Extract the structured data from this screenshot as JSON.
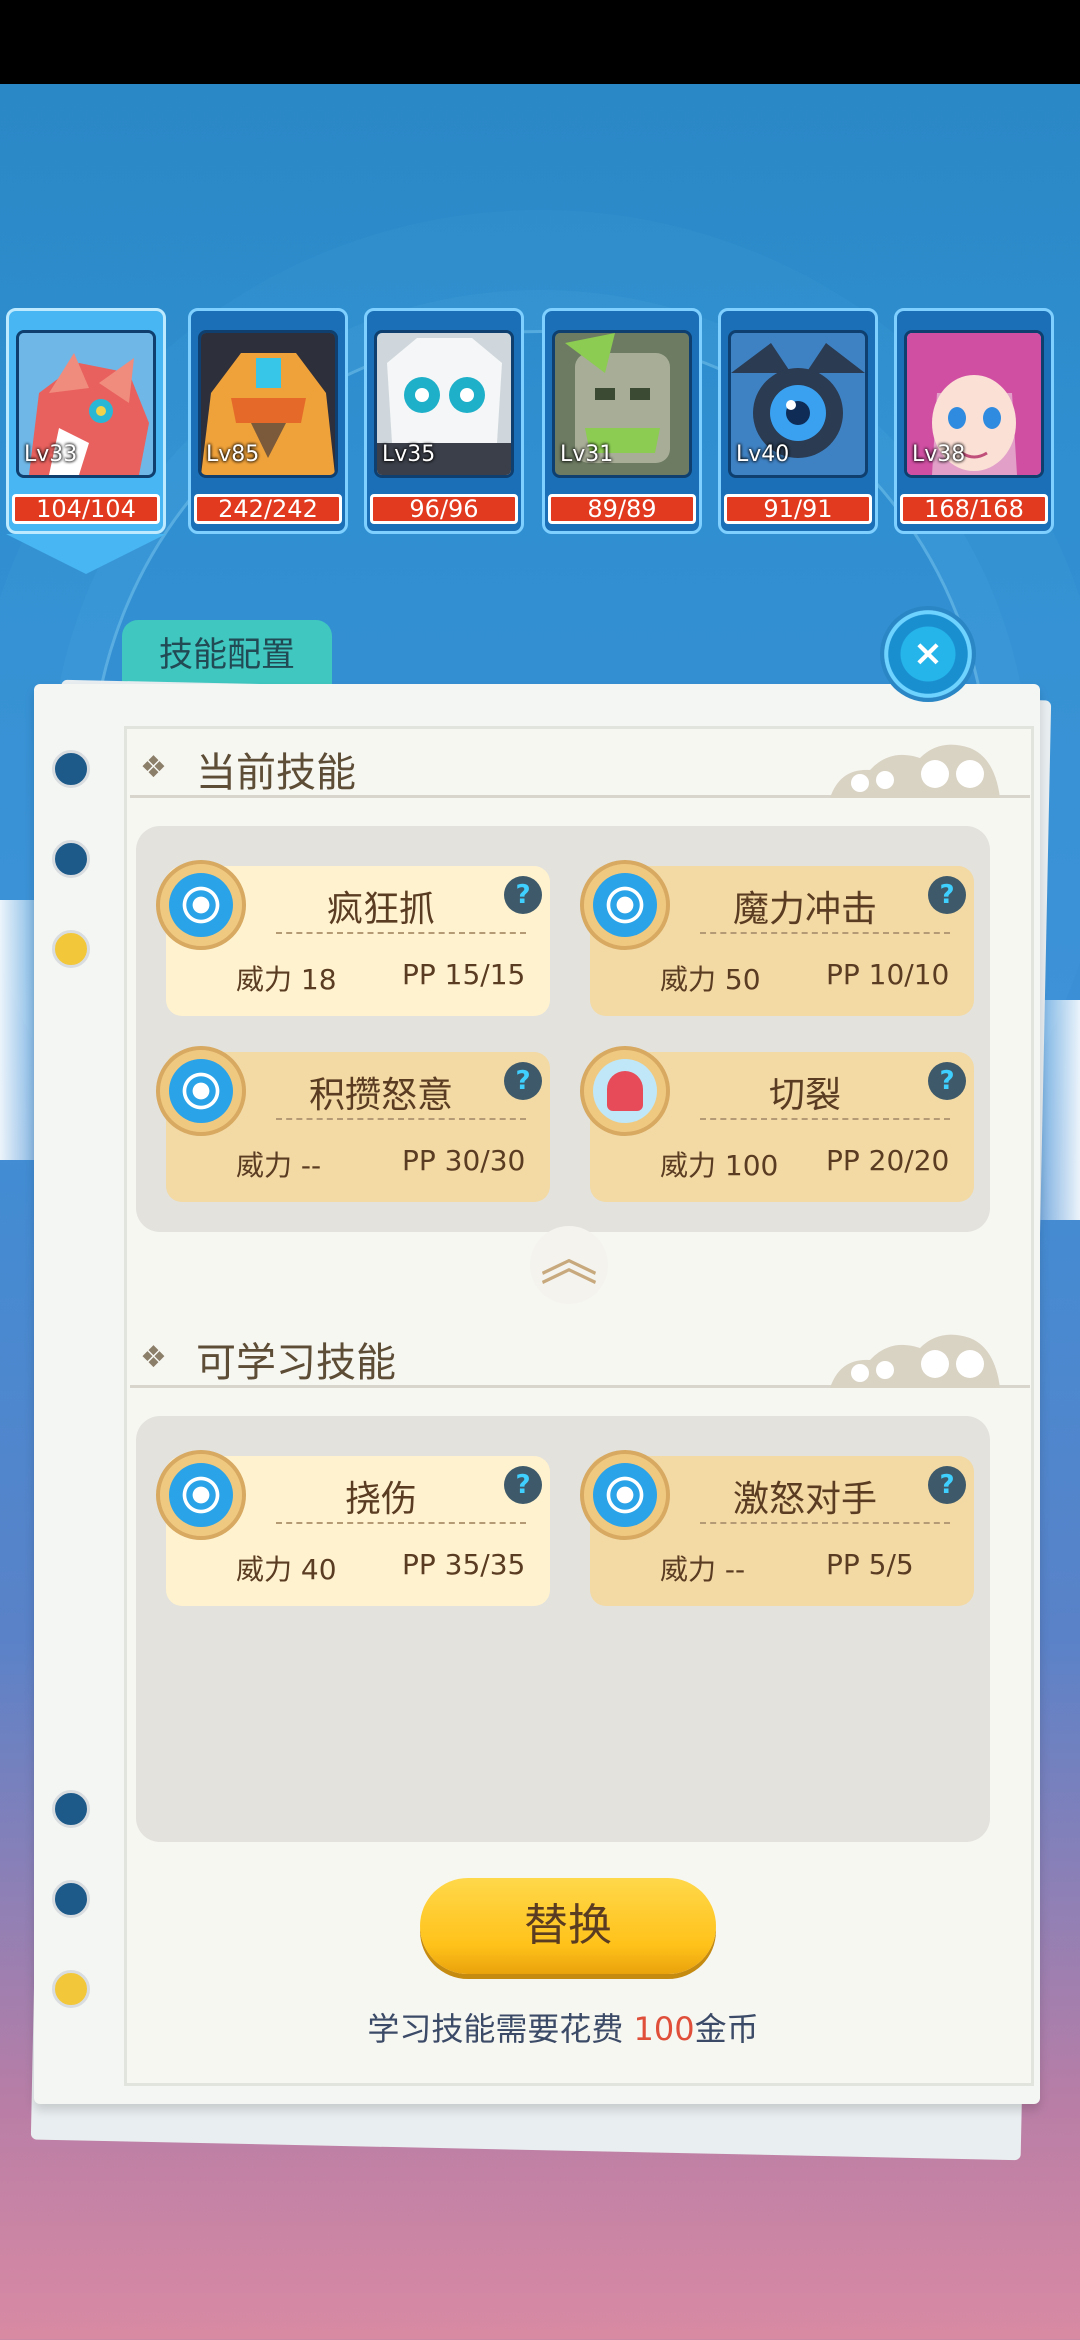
{
  "team": [
    {
      "level": "Lv33",
      "hp": "104/104",
      "active": true,
      "icon": "red-fox-pet-icon"
    },
    {
      "level": "Lv85",
      "hp": "242/242",
      "active": false,
      "icon": "armored-bird-pet-icon"
    },
    {
      "level": "Lv35",
      "hp": "96/96",
      "active": false,
      "icon": "mech-cat-pet-icon"
    },
    {
      "level": "Lv31",
      "hp": "89/89",
      "active": false,
      "icon": "stone-golem-pet-icon"
    },
    {
      "level": "Lv40",
      "hp": "91/91",
      "active": false,
      "icon": "camera-drone-pet-icon"
    },
    {
      "level": "Lv38",
      "hp": "168/168",
      "active": false,
      "icon": "pink-hair-girl-pet-icon"
    }
  ],
  "panel": {
    "tab_label": "技能配置",
    "close_icon": "×"
  },
  "current_skills": {
    "title": "当前技能",
    "skills": [
      {
        "name": "疯狂抓",
        "power": "威力 18",
        "pp": "PP 15/15",
        "style": "light",
        "type": "normal"
      },
      {
        "name": "魔力冲击",
        "power": "威力 50",
        "pp": "PP 10/10",
        "style": "dark",
        "type": "normal"
      },
      {
        "name": "积攒怒意",
        "power": "威力 --",
        "pp": "PP 30/30",
        "style": "dark",
        "type": "normal"
      },
      {
        "name": "切裂",
        "power": "威力 100",
        "pp": "PP 20/20",
        "style": "dark",
        "type": "ghost"
      }
    ]
  },
  "learnable_skills": {
    "title": "可学习技能",
    "skills": [
      {
        "name": "挠伤",
        "power": "威力 40",
        "pp": "PP 35/35",
        "style": "light",
        "type": "normal"
      },
      {
        "name": "激怒对手",
        "power": "威力 --",
        "pp": "PP 5/5",
        "style": "dark",
        "type": "normal"
      }
    ]
  },
  "help_icon": "?",
  "collapse_icon": "︽",
  "section_chevron": "❖",
  "action": {
    "replace_label": "替换",
    "cost_prefix": "学习技能需要花费 ",
    "cost_amount": "100",
    "cost_suffix": "金币"
  }
}
